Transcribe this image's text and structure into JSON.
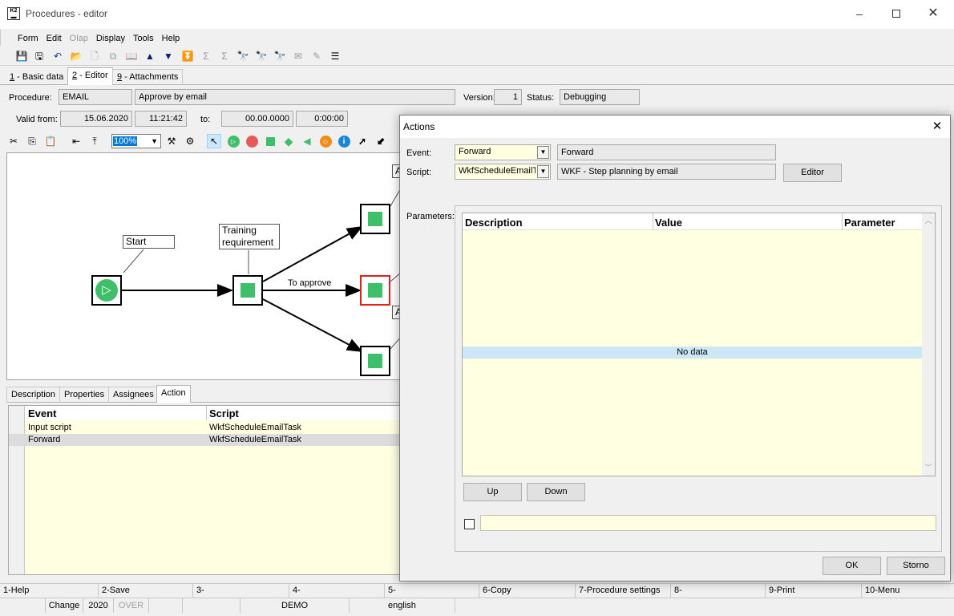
{
  "window": {
    "title": "Procedures - editor"
  },
  "menu": [
    "Form",
    "Edit",
    "Olap",
    "Display",
    "Tools",
    "Help"
  ],
  "tabs": [
    {
      "key": "1",
      "label": " - Basic data"
    },
    {
      "key": "2",
      "label": " - Editor"
    },
    {
      "key": "9",
      "label": " - Attachments"
    }
  ],
  "procedure": {
    "label": "Procedure:",
    "code": "EMAIL",
    "name": "Approve by email",
    "version_label": "Version:",
    "version": "1",
    "status_label": "Status:",
    "status": "Debugging",
    "valid_from_label": "Valid from:",
    "valid_from_date": "15.06.2020",
    "valid_from_time": "11:21:42",
    "to_label": "to:",
    "to_date": "00.00.0000",
    "to_time": "0:00:00"
  },
  "editor": {
    "zoom": "100%"
  },
  "diagram": {
    "start_label": "Start",
    "training_label_1": "Training",
    "training_label_2": "requirement",
    "edge_label": "To approve",
    "partial_label_a1": "A",
    "partial_label_a2": "A"
  },
  "bottom_tabs": [
    "Description",
    "Properties",
    "Assignees",
    "Action"
  ],
  "action_grid": {
    "headers": [
      "Event",
      "Script"
    ],
    "rows": [
      {
        "event": "Input script",
        "script": "WkfScheduleEmailTask"
      },
      {
        "event": "Forward",
        "script": "WkfScheduleEmailTask"
      }
    ]
  },
  "dialog": {
    "title": "Actions",
    "event_label": "Event:",
    "event_value": "Forward",
    "event_desc": "Forward",
    "script_label": "Script:",
    "script_value": "WkfScheduleEmailTa",
    "script_desc": "WKF - Step planning by email",
    "editor_button": "Editor",
    "params_label": "Parameters:",
    "params_headers": [
      "Description",
      "Value",
      "Parameter"
    ],
    "no_data": "No data",
    "up_button": "Up",
    "down_button": "Down",
    "ok_button": "OK",
    "cancel_button": "Storno"
  },
  "fkeys": [
    "1-Help",
    "2-Save",
    "3-",
    "4-",
    "5-",
    "6-Copy",
    "7-Procedure settings",
    "8-",
    "9-Print",
    "10-Menu"
  ],
  "statusbar": [
    "Change",
    "2020",
    "OVER",
    "DEMO",
    "english"
  ],
  "colors": {
    "accent_green": "#3fbf6a",
    "selected_node_border": "#e0201b",
    "grid_yellow": "#ffffe1",
    "no_data_blue": "#cce8f6"
  }
}
